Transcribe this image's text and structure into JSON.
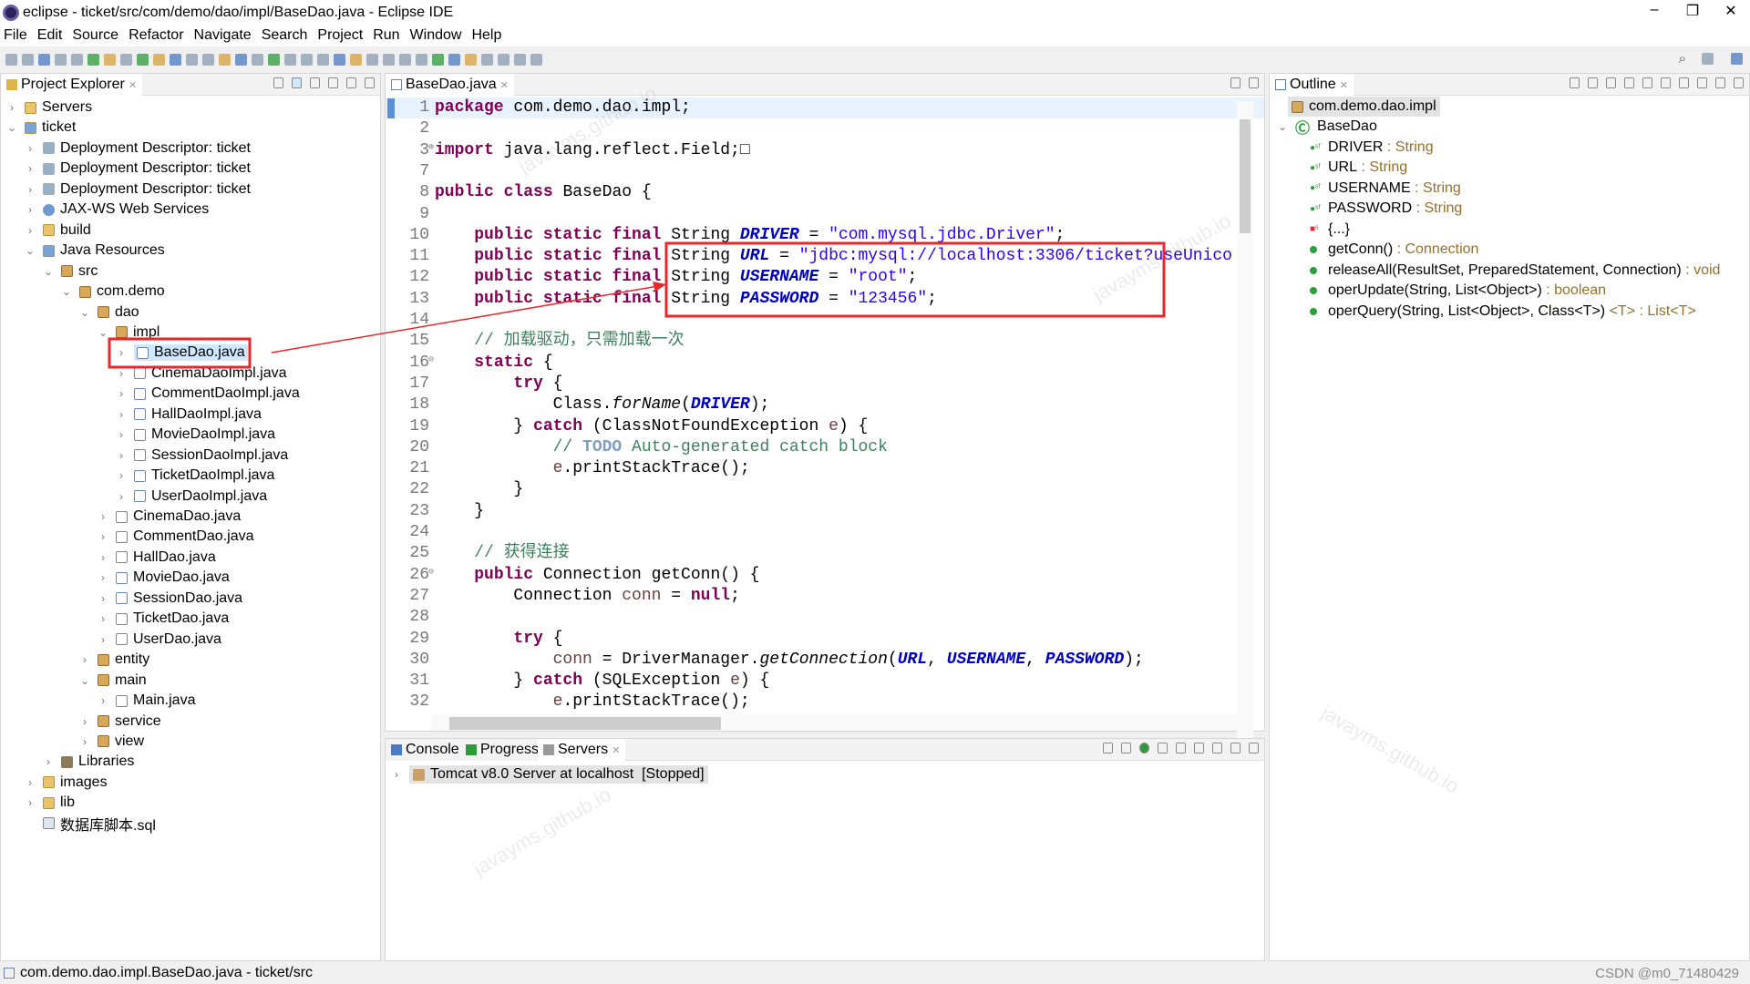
{
  "window": {
    "title": "eclipse - ticket/src/com/demo/dao/impl/BaseDao.java - Eclipse IDE",
    "controls": [
      "–",
      "❐",
      "✕"
    ]
  },
  "menu": [
    "File",
    "Edit",
    "Source",
    "Refactor",
    "Navigate",
    "Search",
    "Project",
    "Run",
    "Window",
    "Help"
  ],
  "project_explorer": {
    "title": "Project Explorer",
    "items": [
      {
        "label": "Servers",
        "level": 0,
        "state": "collapsed",
        "icon": "folder"
      },
      {
        "label": "ticket",
        "level": 0,
        "state": "expanded",
        "icon": "proj"
      },
      {
        "label": "Deployment Descriptor: ticket",
        "level": 1,
        "state": "collapsed",
        "icon": "dd"
      },
      {
        "label": "Deployment Descriptor: ticket",
        "level": 1,
        "state": "collapsed",
        "icon": "dd"
      },
      {
        "label": "Deployment Descriptor: ticket",
        "level": 1,
        "state": "collapsed",
        "icon": "dd"
      },
      {
        "label": "JAX-WS Web Services",
        "level": 1,
        "state": "collapsed",
        "icon": "ws"
      },
      {
        "label": "build",
        "level": 1,
        "state": "collapsed",
        "icon": "folder"
      },
      {
        "label": "Java Resources",
        "level": 1,
        "state": "expanded",
        "icon": "proj"
      },
      {
        "label": "src",
        "level": 2,
        "state": "expanded",
        "icon": "pkg"
      },
      {
        "label": "com.demo",
        "level": 3,
        "state": "expanded",
        "icon": "pkg"
      },
      {
        "label": "dao",
        "level": 4,
        "state": "expanded",
        "icon": "pkg"
      },
      {
        "label": "impl",
        "level": 5,
        "state": "expanded",
        "icon": "pkg"
      },
      {
        "label": "BaseDao.java",
        "level": 6,
        "state": "collapsed",
        "icon": "java",
        "selected": true
      },
      {
        "label": "CinemaDaoImpl.java",
        "level": 6,
        "state": "collapsed",
        "icon": "java"
      },
      {
        "label": "CommentDaoImpl.java",
        "level": 6,
        "state": "collapsed",
        "icon": "java"
      },
      {
        "label": "HallDaoImpl.java",
        "level": 6,
        "state": "collapsed",
        "icon": "java"
      },
      {
        "label": "MovieDaoImpl.java",
        "level": 6,
        "state": "collapsed",
        "icon": "java"
      },
      {
        "label": "SessionDaoImpl.java",
        "level": 6,
        "state": "collapsed",
        "icon": "java"
      },
      {
        "label": "TicketDaoImpl.java",
        "level": 6,
        "state": "collapsed",
        "icon": "java"
      },
      {
        "label": "UserDaoImpl.java",
        "level": 6,
        "state": "collapsed",
        "icon": "java"
      },
      {
        "label": "CinemaDao.java",
        "level": 5,
        "state": "collapsed",
        "icon": "java"
      },
      {
        "label": "CommentDao.java",
        "level": 5,
        "state": "collapsed",
        "icon": "java"
      },
      {
        "label": "HallDao.java",
        "level": 5,
        "state": "collapsed",
        "icon": "java"
      },
      {
        "label": "MovieDao.java",
        "level": 5,
        "state": "collapsed",
        "icon": "java"
      },
      {
        "label": "SessionDao.java",
        "level": 5,
        "state": "collapsed",
        "icon": "java"
      },
      {
        "label": "TicketDao.java",
        "level": 5,
        "state": "collapsed",
        "icon": "java"
      },
      {
        "label": "UserDao.java",
        "level": 5,
        "state": "collapsed",
        "icon": "java"
      },
      {
        "label": "entity",
        "level": 4,
        "state": "collapsed",
        "icon": "pkg"
      },
      {
        "label": "main",
        "level": 4,
        "state": "expanded",
        "icon": "pkg"
      },
      {
        "label": "Main.java",
        "level": 5,
        "state": "collapsed",
        "icon": "java"
      },
      {
        "label": "service",
        "level": 4,
        "state": "collapsed",
        "icon": "pkg"
      },
      {
        "label": "view",
        "level": 4,
        "state": "collapsed",
        "icon": "pkg"
      },
      {
        "label": "Libraries",
        "level": 2,
        "state": "collapsed",
        "icon": "lib"
      },
      {
        "label": "images",
        "level": 1,
        "state": "collapsed",
        "icon": "folder"
      },
      {
        "label": "lib",
        "level": 1,
        "state": "collapsed",
        "icon": "folder"
      },
      {
        "label": "数据库脚本.sql",
        "level": 1,
        "state": "none",
        "icon": "sql"
      }
    ]
  },
  "editor": {
    "tab": "BaseDao.java",
    "lines": [
      {
        "n": "1",
        "t": [
          [
            "kw",
            "package"
          ],
          [
            "",
            " com.demo.dao.impl;"
          ]
        ]
      },
      {
        "n": "2",
        "t": []
      },
      {
        "n": "3",
        "fold": "⊕",
        "t": [
          [
            "kw",
            "import"
          ],
          [
            "",
            " java.lang.reflect.Field;"
          ],
          [
            "",
            "□"
          ]
        ]
      },
      {
        "n": "7",
        "t": []
      },
      {
        "n": "8",
        "t": [
          [
            "kw",
            "public"
          ],
          [
            "",
            " "
          ],
          [
            "kw",
            "class"
          ],
          [
            "",
            " BaseDao {"
          ]
        ]
      },
      {
        "n": "9",
        "t": []
      },
      {
        "n": "10",
        "t": [
          [
            "",
            "    "
          ],
          [
            "kw",
            "public static final"
          ],
          [
            "",
            " String "
          ],
          [
            "cst",
            "DRIVER"
          ],
          [
            "",
            " = "
          ],
          [
            "str",
            "\"com.mysql.jdbc.Driver\""
          ],
          [
            "",
            ";"
          ]
        ]
      },
      {
        "n": "11",
        "t": [
          [
            "",
            "    "
          ],
          [
            "kw",
            "public static final"
          ],
          [
            "",
            " String "
          ],
          [
            "cst",
            "URL"
          ],
          [
            "",
            " = "
          ],
          [
            "str",
            "\"jdbc:mysql://localhost:3306/ticket?useUnico"
          ]
        ]
      },
      {
        "n": "12",
        "t": [
          [
            "",
            "    "
          ],
          [
            "kw",
            "public static final"
          ],
          [
            "",
            " String "
          ],
          [
            "cst",
            "USERNAME"
          ],
          [
            "",
            " = "
          ],
          [
            "str",
            "\"root\""
          ],
          [
            "",
            ";"
          ]
        ]
      },
      {
        "n": "13",
        "t": [
          [
            "",
            "    "
          ],
          [
            "kw",
            "public static final"
          ],
          [
            "",
            " String "
          ],
          [
            "cst",
            "PASSWORD"
          ],
          [
            "",
            " = "
          ],
          [
            "str",
            "\"123456\""
          ],
          [
            "",
            ";"
          ]
        ]
      },
      {
        "n": "14",
        "t": []
      },
      {
        "n": "15",
        "t": [
          [
            "",
            "    "
          ],
          [
            "cm",
            "// 加载驱动，只需加载一次"
          ]
        ]
      },
      {
        "n": "16",
        "fold": "⊖",
        "t": [
          [
            "",
            "    "
          ],
          [
            "kw",
            "static"
          ],
          [
            "",
            " {"
          ]
        ]
      },
      {
        "n": "17",
        "t": [
          [
            "",
            "        "
          ],
          [
            "kw",
            "try"
          ],
          [
            "",
            " {"
          ]
        ]
      },
      {
        "n": "18",
        "t": [
          [
            "",
            "            Class."
          ],
          [
            "it",
            "forName"
          ],
          [
            "",
            "("
          ],
          [
            "cst",
            "DRIVER"
          ],
          [
            "",
            ");"
          ]
        ]
      },
      {
        "n": "19",
        "t": [
          [
            "",
            "        } "
          ],
          [
            "kw",
            "catch"
          ],
          [
            "",
            " (ClassNotFoundException "
          ],
          [
            "var",
            "e"
          ],
          [
            "",
            ") {"
          ]
        ]
      },
      {
        "n": "20",
        "t": [
          [
            "",
            "            "
          ],
          [
            "cm",
            "// "
          ],
          [
            "todo",
            "TODO"
          ],
          [
            "cm",
            " Auto-generated catch block"
          ]
        ]
      },
      {
        "n": "21",
        "t": [
          [
            "",
            "            "
          ],
          [
            "var",
            "e"
          ],
          [
            "",
            ".printStackTrace();"
          ]
        ]
      },
      {
        "n": "22",
        "t": [
          [
            "",
            "        }"
          ]
        ]
      },
      {
        "n": "23",
        "t": [
          [
            "",
            "    }"
          ]
        ]
      },
      {
        "n": "24",
        "t": []
      },
      {
        "n": "25",
        "t": [
          [
            "",
            "    "
          ],
          [
            "cm",
            "// 获得连接"
          ]
        ]
      },
      {
        "n": "26",
        "fold": "⊖",
        "t": [
          [
            "",
            "    "
          ],
          [
            "kw",
            "public"
          ],
          [
            "",
            " Connection getConn() {"
          ]
        ]
      },
      {
        "n": "27",
        "t": [
          [
            "",
            "        Connection "
          ],
          [
            "var",
            "conn"
          ],
          [
            "",
            " = "
          ],
          [
            "kw",
            "null"
          ],
          [
            "",
            ";"
          ]
        ]
      },
      {
        "n": "28",
        "t": []
      },
      {
        "n": "29",
        "t": [
          [
            "",
            "        "
          ],
          [
            "kw",
            "try"
          ],
          [
            "",
            " {"
          ]
        ]
      },
      {
        "n": "30",
        "t": [
          [
            "",
            "            "
          ],
          [
            "var",
            "conn"
          ],
          [
            "",
            " = DriverManager."
          ],
          [
            "it",
            "getConnection"
          ],
          [
            "",
            "("
          ],
          [
            "cst",
            "URL"
          ],
          [
            "",
            ", "
          ],
          [
            "cst",
            "USERNAME"
          ],
          [
            "",
            ", "
          ],
          [
            "cst",
            "PASSWORD"
          ],
          [
            "",
            ");"
          ]
        ]
      },
      {
        "n": "31",
        "t": [
          [
            "",
            "        } "
          ],
          [
            "kw",
            "catch"
          ],
          [
            "",
            " (SQLException "
          ],
          [
            "var",
            "e"
          ],
          [
            "",
            ") {"
          ]
        ]
      },
      {
        "n": "32",
        "t": [
          [
            "",
            "            "
          ],
          [
            "var",
            "e"
          ],
          [
            "",
            ".printStackTrace();"
          ]
        ]
      }
    ]
  },
  "bottom_panel": {
    "tabs": [
      "Console",
      "Progress",
      "Servers"
    ],
    "active_tab": "Servers",
    "server": "Tomcat v8.0 Server at localhost  [Stopped]"
  },
  "outline": {
    "title": "Outline",
    "package": "com.demo.dao.impl",
    "class": "BaseDao",
    "members": [
      {
        "kind": "field",
        "name": "DRIVER",
        "type": " : String"
      },
      {
        "kind": "field",
        "name": "URL",
        "type": " : String"
      },
      {
        "kind": "field",
        "name": "USERNAME",
        "type": " : String"
      },
      {
        "kind": "field",
        "name": "PASSWORD",
        "type": " : String"
      },
      {
        "kind": "static-init",
        "name": "{...}",
        "type": ""
      },
      {
        "kind": "method",
        "name": "getConn()",
        "type": " : Connection"
      },
      {
        "kind": "method",
        "name": "releaseAll(ResultSet, PreparedStatement, Connection)",
        "type": " : void"
      },
      {
        "kind": "method",
        "name": "operUpdate(String, List<Object>)",
        "type": " : boolean"
      },
      {
        "kind": "method",
        "name": "operQuery(String, List<Object>, Class<T>)",
        "type": " <T> : List<T>"
      }
    ]
  },
  "status_bar": {
    "text": "com.demo.dao.impl.BaseDao.java - ticket/src"
  },
  "watermarks": {
    "csdn": "CSDN @m0_71480429",
    "site": "javayms.github.io"
  },
  "colors": {
    "annotation": "#e8262b",
    "selection": "#cde8ff",
    "keyword": "#7f0055",
    "string": "#2a00ff",
    "constant": "#0000c0",
    "comment": "#3f7f5f"
  }
}
